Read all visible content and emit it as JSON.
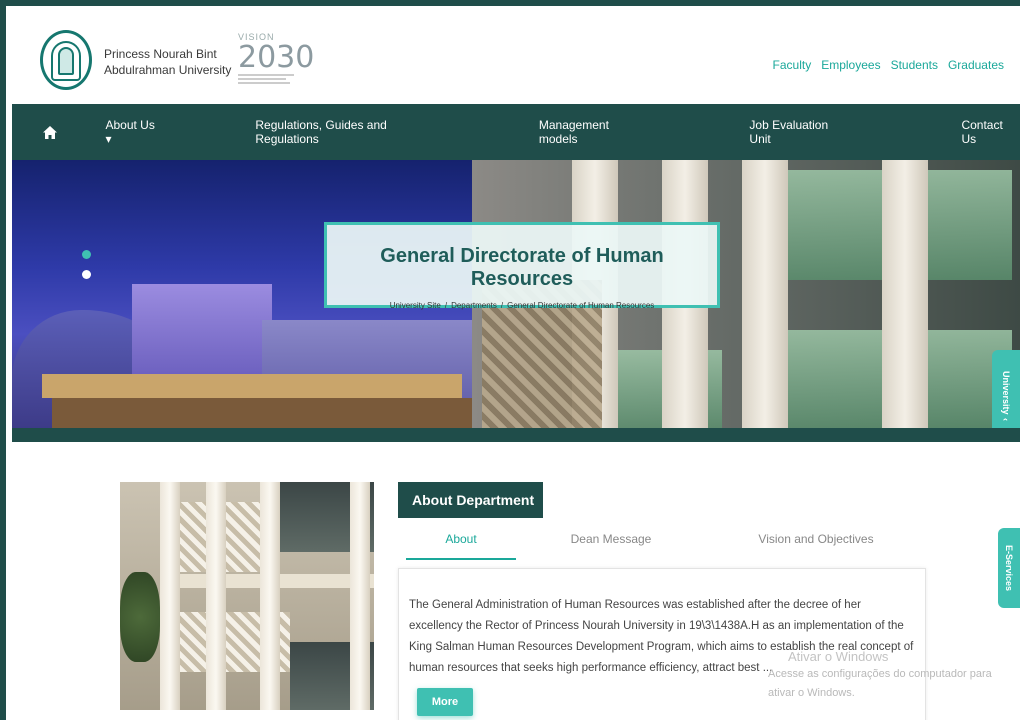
{
  "header": {
    "university_name_line1": "Princess Nourah Bint",
    "university_name_line2": "Abdulrahman University",
    "vision_top": "VISION",
    "vision_number": "2030",
    "top_links": [
      "Faculty",
      "Employees",
      "Students",
      "Graduates"
    ]
  },
  "nav": {
    "items": [
      "About Us ▾",
      "Regulations, Guides and Regulations",
      "Management models",
      "Job Evaluation Unit",
      "Contact Us"
    ]
  },
  "hero": {
    "title": "General Directorate of Human Resources",
    "breadcrumb": [
      "University Site",
      "Departments",
      "General Directorate of Human Resources"
    ],
    "breadcrumb_separator": "/"
  },
  "side_tabs": {
    "university": "University",
    "e_services": "E-Services"
  },
  "content": {
    "section_title": "About Department",
    "tabs": [
      "About",
      "Dean Message",
      "Vision and Objectives"
    ],
    "active_tab": "About",
    "paragraph": "The General Administration of Human Resources was established after the decree of her excellency the Rector of Princess Nourah University in 19\\3\\1438A.H as an implementation of the King Salman Human Resources Development Program, which aims to establish the real concept of human resources that seeks high performance efficiency, attract best ...",
    "more_label": "More"
  },
  "watermark": {
    "title": "Ativar o Windows",
    "line1": "Acesse as configurações do computador para",
    "line2": "ativar o Windows."
  },
  "colors": {
    "primary_dark": "#1f4d4a",
    "accent": "#3fc0b2",
    "link": "#1aa89a"
  }
}
